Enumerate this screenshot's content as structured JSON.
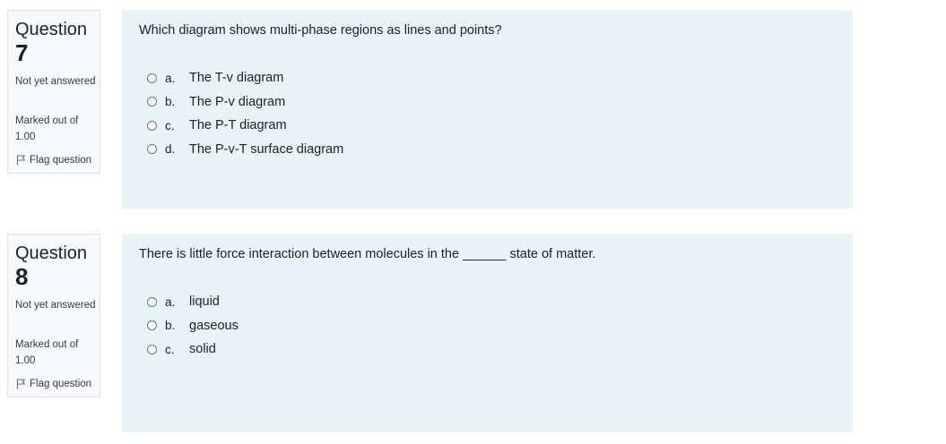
{
  "questions": [
    {
      "label": "Question",
      "number": "7",
      "state": "Not yet answered",
      "grade": "Marked out of 1.00",
      "flag": "Flag question",
      "text": "Which diagram shows multi-phase regions as lines and points?",
      "answers": [
        {
          "letter": "a.",
          "text": "The T-v diagram"
        },
        {
          "letter": "b.",
          "text": "The P-v diagram"
        },
        {
          "letter": "c.",
          "text": "The P-T diagram"
        },
        {
          "letter": "d.",
          "text": "The P-v-T surface diagram"
        }
      ]
    },
    {
      "label": "Question",
      "number": "8",
      "state": "Not yet answered",
      "grade": "Marked out of 1.00",
      "flag": "Flag question",
      "text": "There is little force interaction between molecules in the ______ state of matter.",
      "answers": [
        {
          "letter": "a.",
          "text": "liquid"
        },
        {
          "letter": "b.",
          "text": "gaseous"
        },
        {
          "letter": "c.",
          "text": "solid"
        }
      ]
    }
  ],
  "colors": {
    "info_bg": "#f8f9fa",
    "content_bg": "#e7f3f5",
    "text": "#1d2125"
  },
  "icons": {
    "flag": "flag-icon",
    "radio": "radio-unchecked-icon"
  }
}
